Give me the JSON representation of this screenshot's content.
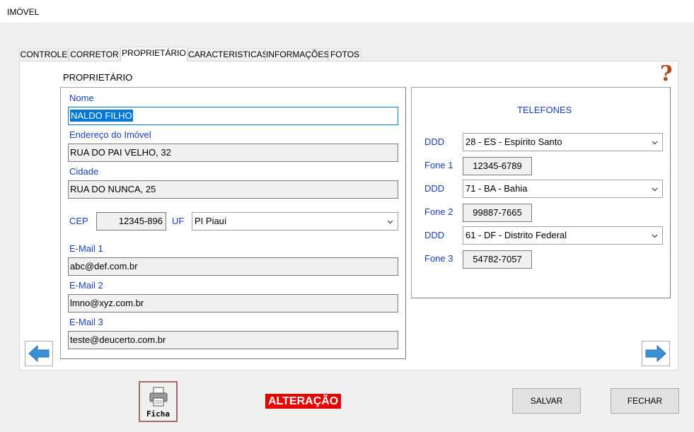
{
  "window": {
    "title": "IMÓVEL"
  },
  "tabs": [
    "CONTROLE",
    "CORRETOR",
    "PROPRIETÁRIO",
    "CARACTERISTICAS",
    "INFORMAÇÕES",
    "FOTOS"
  ],
  "section_title": "PROPRIETÁRIO",
  "help_icon": "question-mark-icon",
  "owner": {
    "nome_label": "Nome",
    "nome": "NALDO FILHO",
    "endereco_label": "Endereço do Imóvel",
    "endereco": "RUA DO PAI VELHO, 32",
    "cidade_label": "Cidade",
    "cidade": "RUA DO NUNCA, 25",
    "cep_label": "CEP",
    "cep": "12345-896",
    "uf_label": "UF",
    "uf": "PI Piauí",
    "email1_label": "E-Mail 1",
    "email1": "abc@def.com.br",
    "email2_label": "E-Mail 2",
    "email2": "lmno@xyz.com.br",
    "email3_label": "E-Mail 3",
    "email3": "teste@deucerto.com.br"
  },
  "phones": {
    "title": "TELEFONES",
    "ddd_label": "DDD",
    "fone1_label": "Fone 1",
    "fone2_label": "Fone 2",
    "fone3_label": "Fone 3",
    "ddd1": "28 - ES - Espírito Santo",
    "fone1": "12345-6789",
    "ddd2": "71 - BA - Bahia",
    "fone2": "99887-7665",
    "ddd3": "61 - DF - Distrito Federal",
    "fone3": "54782-7057"
  },
  "footer": {
    "ficha_label": "Ficha",
    "status": "ALTERAÇÃO",
    "save_label": "SALVAR",
    "close_label": "FECHAR"
  },
  "colors": {
    "label_blue": "#1a3fbf",
    "status_red": "#e60000",
    "selection_blue": "#0078d7",
    "arrow_blue": "#3a8fd6",
    "help_brown": "#b5451b"
  }
}
